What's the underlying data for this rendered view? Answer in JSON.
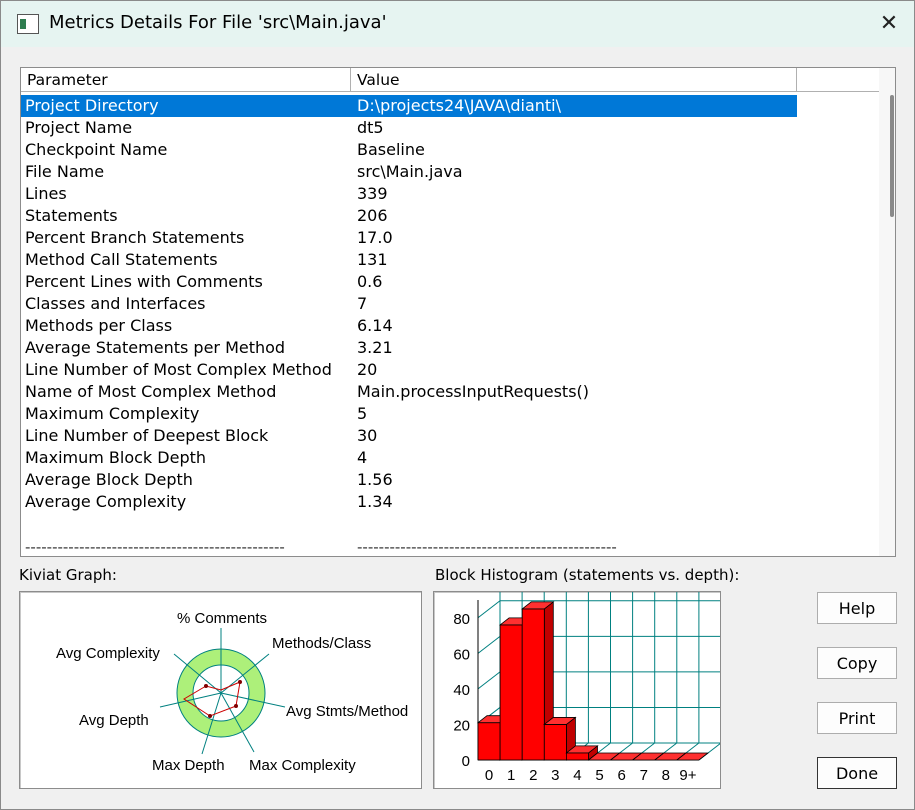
{
  "window": {
    "title": "Metrics Details For File 'src\\Main.java'",
    "close_glyph": "✕"
  },
  "table": {
    "columns": [
      "Parameter",
      "Value",
      ""
    ],
    "rows": [
      {
        "param": "Project Directory",
        "value": "D:\\projects24\\JAVA\\dianti\\"
      },
      {
        "param": "Project Name",
        "value": "dt5"
      },
      {
        "param": "Checkpoint Name",
        "value": "Baseline"
      },
      {
        "param": "File Name",
        "value": "src\\Main.java"
      },
      {
        "param": "Lines",
        "value": "339"
      },
      {
        "param": "Statements",
        "value": "206"
      },
      {
        "param": "Percent Branch Statements",
        "value": "17.0"
      },
      {
        "param": "Method Call Statements",
        "value": "131"
      },
      {
        "param": "Percent Lines with Comments",
        "value": "0.6"
      },
      {
        "param": "Classes and Interfaces",
        "value": "7"
      },
      {
        "param": "Methods per Class",
        "value": "6.14"
      },
      {
        "param": "Average Statements per Method",
        "value": "3.21"
      },
      {
        "param": "Line Number of Most Complex Method",
        "value": "20"
      },
      {
        "param": "Name of Most Complex Method",
        "value": "Main.processInputRequests()"
      },
      {
        "param": "Maximum Complexity",
        "value": "5"
      },
      {
        "param": "Line Number of Deepest Block",
        "value": "30"
      },
      {
        "param": "Maximum Block Depth",
        "value": "4"
      },
      {
        "param": "Average Block Depth",
        "value": "1.56"
      },
      {
        "param": "Average Complexity",
        "value": "1.34"
      }
    ],
    "separator_left": "------------------------------------------------",
    "separator_right": "------------------------------------------------"
  },
  "kiviat": {
    "label": "Kiviat Graph:",
    "axes": [
      "% Comments",
      "Methods/Class",
      "Avg Stmts/Method",
      "Max Complexity",
      "Max Depth",
      "Avg Depth",
      "Avg Complexity"
    ]
  },
  "histogram": {
    "label": "Block Histogram (statements vs. depth):"
  },
  "buttons": {
    "help": "Help",
    "copy": "Copy",
    "print": "Print",
    "done": "Done"
  },
  "colors": {
    "selection": "#0078d7",
    "kiviat_band": "#adf07a",
    "kiviat_axis": "#008080",
    "bar": "#ff0000"
  },
  "chart_data": {
    "type": "bar",
    "categories": [
      "0",
      "1",
      "2",
      "3",
      "4",
      "5",
      "6",
      "7",
      "8",
      "9+"
    ],
    "values": [
      21,
      76,
      85,
      20,
      4,
      0,
      0,
      0,
      0,
      0
    ],
    "ylim": [
      0,
      90
    ],
    "yticks": [
      "0",
      "20",
      "40",
      "60",
      "80"
    ],
    "title": "",
    "xlabel": "",
    "ylabel": ""
  }
}
